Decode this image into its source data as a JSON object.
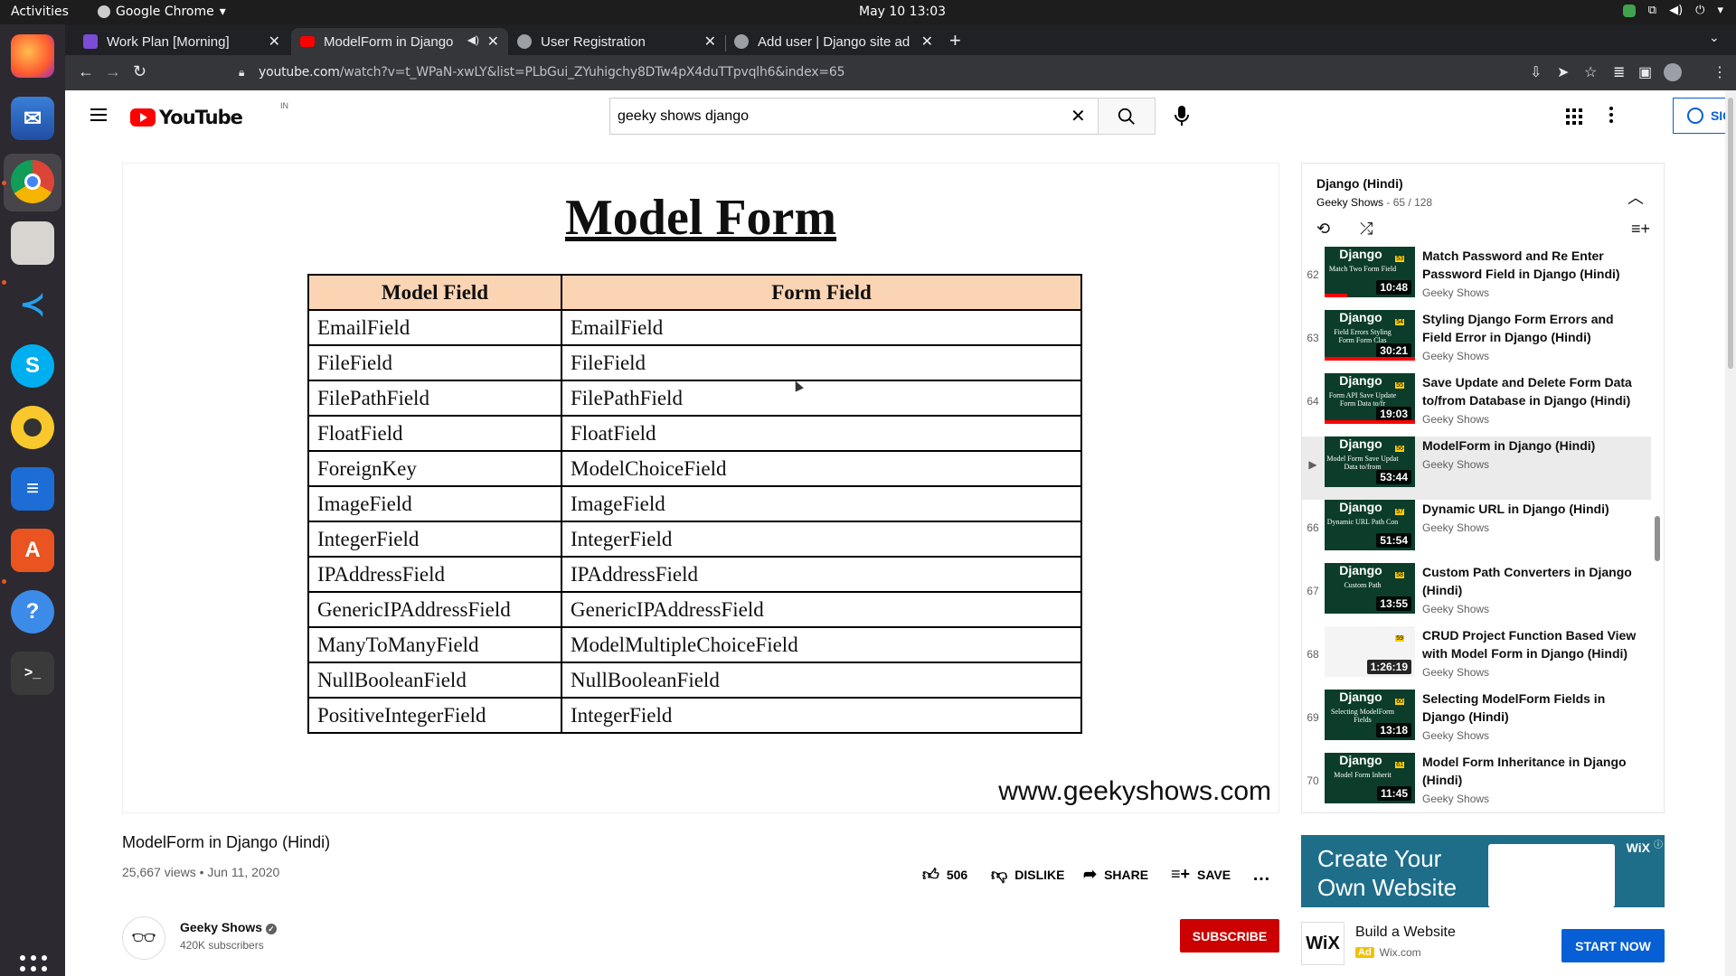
{
  "os": {
    "activities": "Activities",
    "app_name": "Google Chrome",
    "clock": "May 10  13:03"
  },
  "tabs": [
    {
      "label": "Work Plan [Morning]",
      "icon_color": "#7b4cd6"
    },
    {
      "label": "ModelForm in Django",
      "icon_color": "#ff0000"
    },
    {
      "label": "User Registration",
      "icon_color": "#9aa0a6"
    },
    {
      "label": "Add user | Django site ad",
      "icon_color": "#9aa0a6"
    }
  ],
  "address_bar": {
    "host": "youtube.com",
    "path": "/watch?v=t_WPaN-xwLY&list=PLbGui_ZYuhigchy8DTw4pX4duTTpvqlh6&index=65"
  },
  "youtube": {
    "logo_text": "YouTube",
    "country": "IN",
    "search_value": "geeky shows django",
    "sign_in": "SIGN IN"
  },
  "video_slide": {
    "title": "Model Form",
    "headers": [
      "Model Field",
      "Form Field"
    ],
    "rows": [
      [
        "EmailField",
        "EmailField"
      ],
      [
        "FileField",
        "FileField"
      ],
      [
        "FilePathField",
        "FilePathField"
      ],
      [
        "FloatField",
        "FloatField"
      ],
      [
        "ForeignKey",
        "ModelChoiceField"
      ],
      [
        "ImageField",
        "ImageField"
      ],
      [
        "IntegerField",
        "IntegerField"
      ],
      [
        "IPAddressField",
        "IPAddressField"
      ],
      [
        "GenericIPAddressField",
        "GenericIPAddressField"
      ],
      [
        "ManyToManyField",
        "ModelMultipleChoiceField"
      ],
      [
        "NullBooleanField",
        "NullBooleanField"
      ],
      [
        "PositiveIntegerField",
        "IntegerField"
      ]
    ],
    "watermark": "www.geekyshows.com"
  },
  "video_info": {
    "title": "ModelForm in Django (Hindi)",
    "meta": "25,667 views • Jun 11, 2020",
    "likes": "506",
    "dislike": "DISLIKE",
    "share": "SHARE",
    "save": "SAVE",
    "channel": "Geeky Shows",
    "subscribers": "420K subscribers",
    "subscribe": "SUBSCRIBE"
  },
  "playlist": {
    "title": "Django (Hindi)",
    "owner": "Geeky Shows",
    "position": "65 / 128",
    "items": [
      {
        "index": "62",
        "title": "Match Password and Re Enter Password Field in Django (Hindi)",
        "channel": "Geeky Shows",
        "duration": "10:48",
        "thumb_text": "Match Two Form Field",
        "badge": "53",
        "progress": 0.25
      },
      {
        "index": "63",
        "title": "Styling Django Form Errors and Field Error in Django (Hindi)",
        "channel": "Geeky Shows",
        "duration": "30:21",
        "thumb_text": "Field Errors Styling Form Form Clas",
        "badge": "54",
        "progress": 1
      },
      {
        "index": "64",
        "title": "Save Update and Delete Form Data to/from Database in Django (Hindi)",
        "channel": "Geeky Shows",
        "duration": "19:03",
        "thumb_text": "Form API Save Update Form Data to/fr",
        "badge": "55",
        "progress": 1
      },
      {
        "index": "▶",
        "title": "ModelForm in Django (Hindi)",
        "channel": "Geeky Shows",
        "duration": "53:44",
        "thumb_text": "Model Form Save Updat Data to/from",
        "badge": "56",
        "progress": 0
      },
      {
        "index": "66",
        "title": "Dynamic URL in Django (Hindi)",
        "channel": "Geeky Shows",
        "duration": "51:54",
        "thumb_text": "Dynamic URL Path Con",
        "badge": "57",
        "progress": 0
      },
      {
        "index": "67",
        "title": "Custom Path Converters in Django (Hindi)",
        "channel": "Geeky Shows",
        "duration": "13:55",
        "thumb_text": "Custom Path",
        "badge": "58",
        "progress": 0
      },
      {
        "index": "68",
        "title": "CRUD Project Function Based View with Model Form in Django (Hindi)",
        "channel": "Geeky Shows",
        "duration": "1:26:19",
        "thumb_text": "",
        "badge": "59",
        "progress": 0
      },
      {
        "index": "69",
        "title": "Selecting ModelForm Fields in Django (Hindi)",
        "channel": "Geeky Shows",
        "duration": "13:18",
        "thumb_text": "Selecting ModelForm Fields",
        "badge": "60",
        "progress": 0
      },
      {
        "index": "70",
        "title": "Model Form Inheritance in Django (Hindi)",
        "channel": "Geeky Shows",
        "duration": "11:45",
        "thumb_text": "Model Form Inherit",
        "badge": "61",
        "progress": 0
      }
    ]
  },
  "ad": {
    "banner_line1": "Create Your",
    "banner_line2": "Own Website",
    "brand_small": "WiX",
    "logo": "WiX",
    "title": "Build a Website",
    "tag": "Ad",
    "domain": "Wix.com",
    "cta": "START NOW"
  },
  "dock_icons": [
    "firefox-icon",
    "thunderbird-icon",
    "chrome-icon",
    "files-icon",
    "vscode-icon",
    "skype-icon",
    "rhythmbox-icon",
    "writer-icon",
    "software-icon",
    "help-icon",
    "terminal-icon"
  ]
}
